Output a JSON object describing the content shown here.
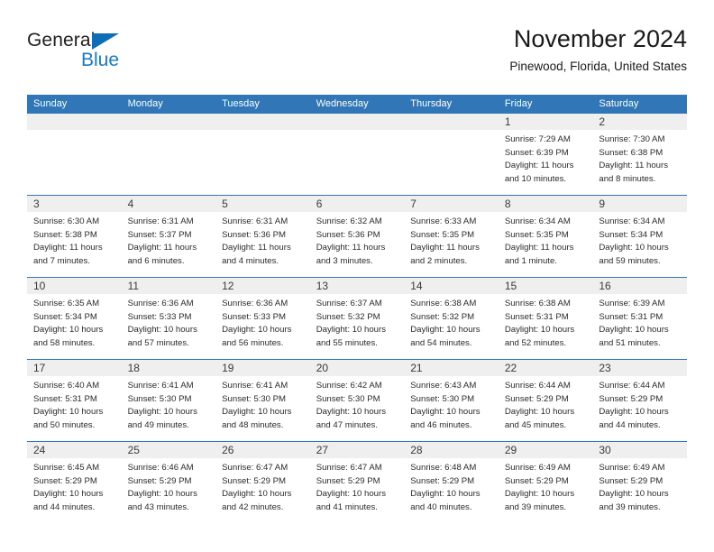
{
  "logo": {
    "word_top": "General",
    "word_bottom": "Blue",
    "triangle_color": "#0f6cb6",
    "blue_text_color": "#1a7ac4"
  },
  "header": {
    "month_title": "November 2024",
    "location": "Pinewood, Florida, United States"
  },
  "theme": {
    "header_blue": "#3176b6",
    "daynum_band": "#efefef",
    "text": "#2b2b2b"
  },
  "weekday_headers": [
    "Sunday",
    "Monday",
    "Tuesday",
    "Wednesday",
    "Thursday",
    "Friday",
    "Saturday"
  ],
  "weeks": [
    [
      {
        "day": "",
        "sunrise": "",
        "sunset": "",
        "daylight_1": "",
        "daylight_2": ""
      },
      {
        "day": "",
        "sunrise": "",
        "sunset": "",
        "daylight_1": "",
        "daylight_2": ""
      },
      {
        "day": "",
        "sunrise": "",
        "sunset": "",
        "daylight_1": "",
        "daylight_2": ""
      },
      {
        "day": "",
        "sunrise": "",
        "sunset": "",
        "daylight_1": "",
        "daylight_2": ""
      },
      {
        "day": "",
        "sunrise": "",
        "sunset": "",
        "daylight_1": "",
        "daylight_2": ""
      },
      {
        "day": "1",
        "sunrise": "Sunrise: 7:29 AM",
        "sunset": "Sunset: 6:39 PM",
        "daylight_1": "Daylight: 11 hours",
        "daylight_2": "and 10 minutes."
      },
      {
        "day": "2",
        "sunrise": "Sunrise: 7:30 AM",
        "sunset": "Sunset: 6:38 PM",
        "daylight_1": "Daylight: 11 hours",
        "daylight_2": "and 8 minutes."
      }
    ],
    [
      {
        "day": "3",
        "sunrise": "Sunrise: 6:30 AM",
        "sunset": "Sunset: 5:38 PM",
        "daylight_1": "Daylight: 11 hours",
        "daylight_2": "and 7 minutes."
      },
      {
        "day": "4",
        "sunrise": "Sunrise: 6:31 AM",
        "sunset": "Sunset: 5:37 PM",
        "daylight_1": "Daylight: 11 hours",
        "daylight_2": "and 6 minutes."
      },
      {
        "day": "5",
        "sunrise": "Sunrise: 6:31 AM",
        "sunset": "Sunset: 5:36 PM",
        "daylight_1": "Daylight: 11 hours",
        "daylight_2": "and 4 minutes."
      },
      {
        "day": "6",
        "sunrise": "Sunrise: 6:32 AM",
        "sunset": "Sunset: 5:36 PM",
        "daylight_1": "Daylight: 11 hours",
        "daylight_2": "and 3 minutes."
      },
      {
        "day": "7",
        "sunrise": "Sunrise: 6:33 AM",
        "sunset": "Sunset: 5:35 PM",
        "daylight_1": "Daylight: 11 hours",
        "daylight_2": "and 2 minutes."
      },
      {
        "day": "8",
        "sunrise": "Sunrise: 6:34 AM",
        "sunset": "Sunset: 5:35 PM",
        "daylight_1": "Daylight: 11 hours",
        "daylight_2": "and 1 minute."
      },
      {
        "day": "9",
        "sunrise": "Sunrise: 6:34 AM",
        "sunset": "Sunset: 5:34 PM",
        "daylight_1": "Daylight: 10 hours",
        "daylight_2": "and 59 minutes."
      }
    ],
    [
      {
        "day": "10",
        "sunrise": "Sunrise: 6:35 AM",
        "sunset": "Sunset: 5:34 PM",
        "daylight_1": "Daylight: 10 hours",
        "daylight_2": "and 58 minutes."
      },
      {
        "day": "11",
        "sunrise": "Sunrise: 6:36 AM",
        "sunset": "Sunset: 5:33 PM",
        "daylight_1": "Daylight: 10 hours",
        "daylight_2": "and 57 minutes."
      },
      {
        "day": "12",
        "sunrise": "Sunrise: 6:36 AM",
        "sunset": "Sunset: 5:33 PM",
        "daylight_1": "Daylight: 10 hours",
        "daylight_2": "and 56 minutes."
      },
      {
        "day": "13",
        "sunrise": "Sunrise: 6:37 AM",
        "sunset": "Sunset: 5:32 PM",
        "daylight_1": "Daylight: 10 hours",
        "daylight_2": "and 55 minutes."
      },
      {
        "day": "14",
        "sunrise": "Sunrise: 6:38 AM",
        "sunset": "Sunset: 5:32 PM",
        "daylight_1": "Daylight: 10 hours",
        "daylight_2": "and 54 minutes."
      },
      {
        "day": "15",
        "sunrise": "Sunrise: 6:38 AM",
        "sunset": "Sunset: 5:31 PM",
        "daylight_1": "Daylight: 10 hours",
        "daylight_2": "and 52 minutes."
      },
      {
        "day": "16",
        "sunrise": "Sunrise: 6:39 AM",
        "sunset": "Sunset: 5:31 PM",
        "daylight_1": "Daylight: 10 hours",
        "daylight_2": "and 51 minutes."
      }
    ],
    [
      {
        "day": "17",
        "sunrise": "Sunrise: 6:40 AM",
        "sunset": "Sunset: 5:31 PM",
        "daylight_1": "Daylight: 10 hours",
        "daylight_2": "and 50 minutes."
      },
      {
        "day": "18",
        "sunrise": "Sunrise: 6:41 AM",
        "sunset": "Sunset: 5:30 PM",
        "daylight_1": "Daylight: 10 hours",
        "daylight_2": "and 49 minutes."
      },
      {
        "day": "19",
        "sunrise": "Sunrise: 6:41 AM",
        "sunset": "Sunset: 5:30 PM",
        "daylight_1": "Daylight: 10 hours",
        "daylight_2": "and 48 minutes."
      },
      {
        "day": "20",
        "sunrise": "Sunrise: 6:42 AM",
        "sunset": "Sunset: 5:30 PM",
        "daylight_1": "Daylight: 10 hours",
        "daylight_2": "and 47 minutes."
      },
      {
        "day": "21",
        "sunrise": "Sunrise: 6:43 AM",
        "sunset": "Sunset: 5:30 PM",
        "daylight_1": "Daylight: 10 hours",
        "daylight_2": "and 46 minutes."
      },
      {
        "day": "22",
        "sunrise": "Sunrise: 6:44 AM",
        "sunset": "Sunset: 5:29 PM",
        "daylight_1": "Daylight: 10 hours",
        "daylight_2": "and 45 minutes."
      },
      {
        "day": "23",
        "sunrise": "Sunrise: 6:44 AM",
        "sunset": "Sunset: 5:29 PM",
        "daylight_1": "Daylight: 10 hours",
        "daylight_2": "and 44 minutes."
      }
    ],
    [
      {
        "day": "24",
        "sunrise": "Sunrise: 6:45 AM",
        "sunset": "Sunset: 5:29 PM",
        "daylight_1": "Daylight: 10 hours",
        "daylight_2": "and 44 minutes."
      },
      {
        "day": "25",
        "sunrise": "Sunrise: 6:46 AM",
        "sunset": "Sunset: 5:29 PM",
        "daylight_1": "Daylight: 10 hours",
        "daylight_2": "and 43 minutes."
      },
      {
        "day": "26",
        "sunrise": "Sunrise: 6:47 AM",
        "sunset": "Sunset: 5:29 PM",
        "daylight_1": "Daylight: 10 hours",
        "daylight_2": "and 42 minutes."
      },
      {
        "day": "27",
        "sunrise": "Sunrise: 6:47 AM",
        "sunset": "Sunset: 5:29 PM",
        "daylight_1": "Daylight: 10 hours",
        "daylight_2": "and 41 minutes."
      },
      {
        "day": "28",
        "sunrise": "Sunrise: 6:48 AM",
        "sunset": "Sunset: 5:29 PM",
        "daylight_1": "Daylight: 10 hours",
        "daylight_2": "and 40 minutes."
      },
      {
        "day": "29",
        "sunrise": "Sunrise: 6:49 AM",
        "sunset": "Sunset: 5:29 PM",
        "daylight_1": "Daylight: 10 hours",
        "daylight_2": "and 39 minutes."
      },
      {
        "day": "30",
        "sunrise": "Sunrise: 6:49 AM",
        "sunset": "Sunset: 5:29 PM",
        "daylight_1": "Daylight: 10 hours",
        "daylight_2": "and 39 minutes."
      }
    ]
  ]
}
